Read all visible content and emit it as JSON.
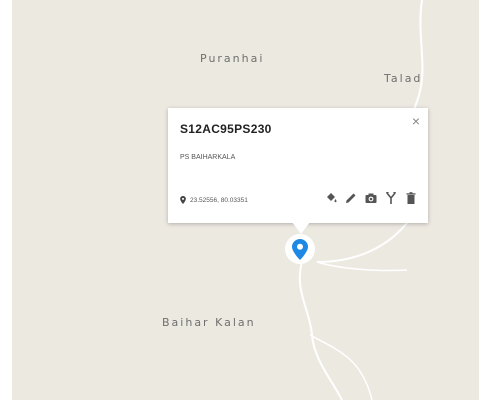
{
  "map": {
    "places": [
      {
        "id": "puranhai",
        "label": "Puranhai"
      },
      {
        "id": "talad",
        "label": "Talad"
      },
      {
        "id": "baihar-kalan",
        "label": "Baihar Kalan"
      }
    ],
    "colors": {
      "land": "#ece9e1",
      "road": "#ffffff",
      "marker": "#1e88e5"
    }
  },
  "popup": {
    "title": "S12AC95PS230",
    "subtitle": "PS BAIHARKALA",
    "coordinates": "23.52556, 80.03351",
    "close_label": "×",
    "tools": [
      "paint-bucket-icon",
      "pencil-icon",
      "camera-icon",
      "route-icon",
      "trash-icon"
    ]
  }
}
